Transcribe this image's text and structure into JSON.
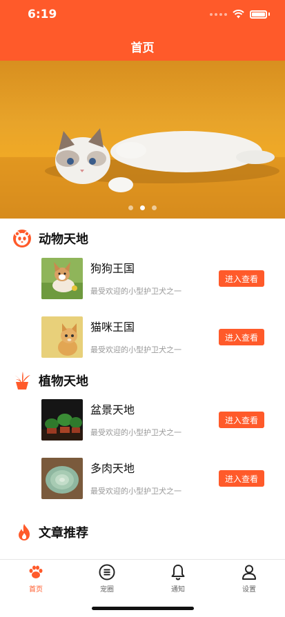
{
  "status_bar": {
    "time": "6:19"
  },
  "nav": {
    "title": "首页"
  },
  "banner": {
    "dots": 3,
    "active_dot": 1
  },
  "sections": {
    "animals": {
      "title": "动物天地",
      "items": [
        {
          "title": "狗狗王国",
          "desc": "最受欢迎的小型护卫犬之一",
          "button": "进入查看"
        },
        {
          "title": "猫咪王国",
          "desc": "最受欢迎的小型护卫犬之一",
          "button": "进入查看"
        }
      ]
    },
    "plants": {
      "title": "植物天地",
      "items": [
        {
          "title": "盆景天地",
          "desc": "最受欢迎的小型护卫犬之一",
          "button": "进入查看"
        },
        {
          "title": "多肉天地",
          "desc": "最受欢迎的小型护卫犬之一",
          "button": "进入查看"
        }
      ]
    },
    "articles": {
      "title": "文章推荐"
    }
  },
  "tabbar": {
    "tabs": [
      {
        "label": "首页",
        "icon": "paw-icon",
        "active": true
      },
      {
        "label": "宠圈",
        "icon": "list-circle-icon",
        "active": false
      },
      {
        "label": "通知",
        "icon": "bell-icon",
        "active": false
      },
      {
        "label": "设置",
        "icon": "user-icon",
        "active": false
      }
    ]
  },
  "colors": {
    "accent": "#ff5a2a",
    "banner": "#e8a42a"
  }
}
